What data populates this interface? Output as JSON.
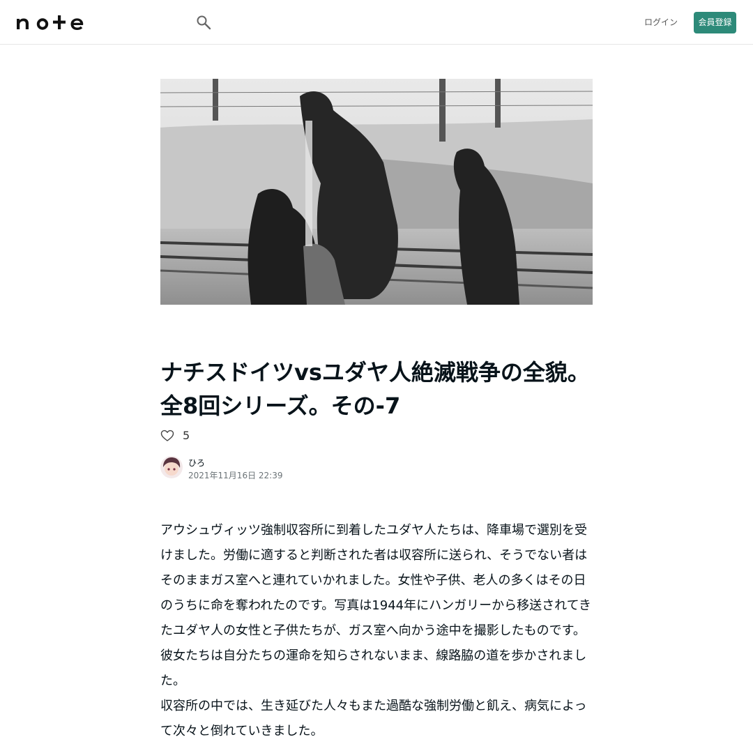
{
  "header": {
    "logo_text": "note",
    "search_icon": "search-icon",
    "login_label": "ログイン",
    "signup_label": "会員登録"
  },
  "article": {
    "hero_image_alt": "強制収容所の線路脇を歩く女性と子供たちのモノクロ写真",
    "title": "ナチスドイツvsユダヤ人絶滅戦争の全貌。全8回シリーズ。その-7",
    "likes": "5",
    "author_name": "ひろ",
    "published_at": "2021年11月16日 22:39",
    "paragraph1": "アウシュヴィッツ強制収容所に到着したユダヤ人たちは、降車場で選別を受けました。労働に適すると判断された者は収容所に送られ、そうでない者はそのままガス室へと連れていかれました。女性や子供、老人の多くはその日のうちに命を奪われたのです。写真は1944年にハンガリーから移送されてきたユダヤ人の女性と子供たちが、ガス室へ向かう途中を撮影したものです。彼女たちは自分たちの運命を知らされないまま、線路脇の道を歩かされました。",
    "paragraph2": "収容所の中では、生き延びた人々もまた過酷な強制労働と飢え、病気によって次々と倒れていきました。"
  },
  "colors": {
    "accent": "#2d8a79",
    "text": "#08131a",
    "muted": "#6b7377"
  }
}
